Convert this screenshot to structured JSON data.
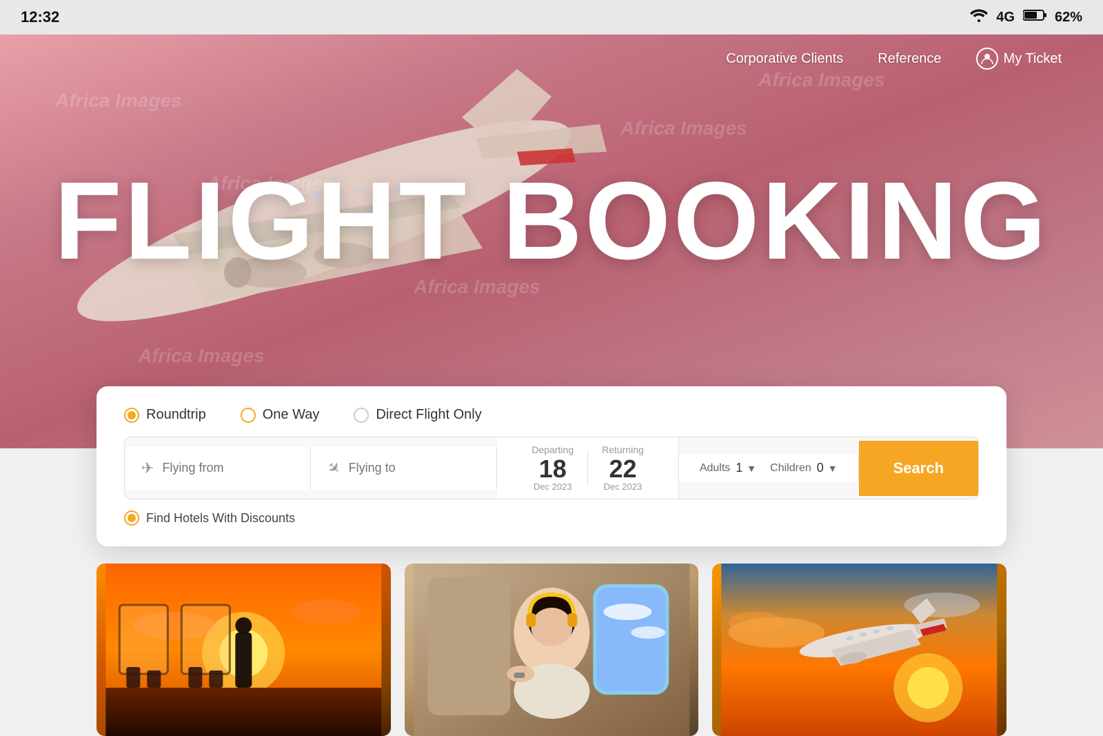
{
  "statusBar": {
    "time": "12:32",
    "signal": "4G",
    "battery": "62%"
  },
  "nav": {
    "corporativeClients": "Corporative Clients",
    "reference": "Reference",
    "myTicket": "My Ticket"
  },
  "hero": {
    "title": "FLIGHT BOOKING"
  },
  "tripOptions": [
    {
      "id": "roundtrip",
      "label": "Roundtrip",
      "active": true
    },
    {
      "id": "oneway",
      "label": "One Way",
      "active": false
    },
    {
      "id": "directonly",
      "label": "Direct Flight Only",
      "active": false
    }
  ],
  "searchForm": {
    "flyingFrom": {
      "placeholder": "Flying from",
      "value": ""
    },
    "flyingTo": {
      "placeholder": "Flying to",
      "value": ""
    },
    "departing": {
      "label": "Departing",
      "day": "18",
      "month": "Dec 2023"
    },
    "returning": {
      "label": "Returning",
      "day": "22",
      "month": "Dec 2023"
    },
    "adults": {
      "label": "Adults",
      "value": "1"
    },
    "children": {
      "label": "Children",
      "value": "0"
    },
    "searchButton": "Search"
  },
  "hotelsOption": {
    "label": "Find Hotels With Discounts"
  }
}
